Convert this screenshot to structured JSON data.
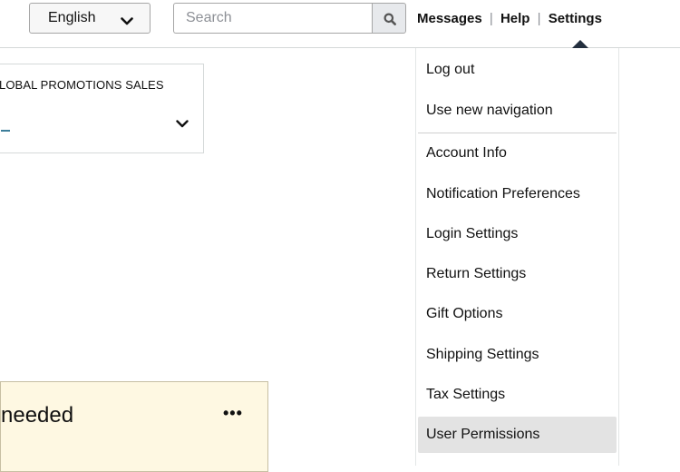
{
  "header": {
    "language": {
      "selected": "English",
      "icon": "chevron-down-icon"
    },
    "search": {
      "placeholder": "Search",
      "value": "",
      "icon": "search-icon"
    },
    "nav": {
      "messages": "Messages",
      "help": "Help",
      "settings": "Settings",
      "separator": "|"
    }
  },
  "promo_card": {
    "title": "LOBAL PROMOTIONS SALES",
    "icon": "chevron-down-icon"
  },
  "alert_card": {
    "text": "needed",
    "more": "•••",
    "background": "#fef8e2"
  },
  "settings_menu": {
    "items": [
      {
        "label": "Log out"
      },
      {
        "label": "Use new navigation"
      },
      {
        "label": "Account Info"
      },
      {
        "label": "Notification Preferences"
      },
      {
        "label": "Login Settings"
      },
      {
        "label": "Return Settings"
      },
      {
        "label": "Gift Options"
      },
      {
        "label": "Shipping Settings"
      },
      {
        "label": "Tax Settings"
      },
      {
        "label": "User Permissions",
        "active": true
      }
    ]
  },
  "colors": {
    "caret": "#232f3e",
    "active_item": "#e3e3e3",
    "accent": "#3d7e9a"
  }
}
